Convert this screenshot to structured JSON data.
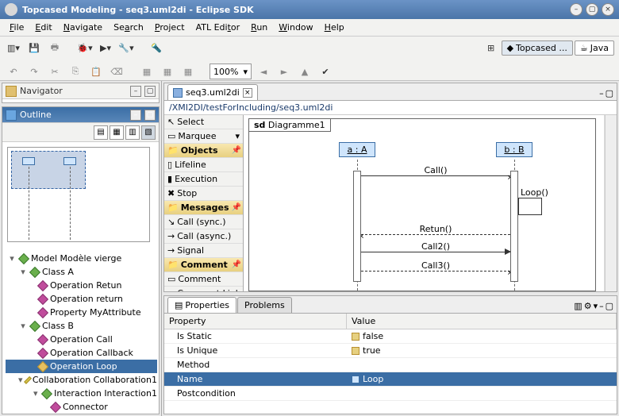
{
  "window": {
    "title": "Topcased Modeling - seq3.uml2di - Eclipse SDK"
  },
  "menus": [
    "File",
    "Edit",
    "Navigate",
    "Search",
    "Project",
    "ATL Editor",
    "Run",
    "Window",
    "Help"
  ],
  "zoom": "100%",
  "perspectives": {
    "active": "Topcased ...",
    "other": "Java"
  },
  "navigator": {
    "title": "Navigator"
  },
  "outline": {
    "title": "Outline",
    "root": "Model Modèle vierge",
    "classA": {
      "label": "Class A",
      "ops": [
        "Operation Retun",
        "Operation return",
        "Property MyAttribute"
      ]
    },
    "classB": {
      "label": "Class B",
      "ops": [
        "Operation Call",
        "Operation Callback",
        "Operation Loop"
      ]
    },
    "collab": "Collaboration Collaboration1",
    "interaction": "Interaction Interaction1",
    "connector": "Connector"
  },
  "editor": {
    "tab": "seq3.uml2di",
    "path": "/XMI2DI/testForIncluding/seq3.uml2di",
    "palette": {
      "select": "Select",
      "marquee": "Marquee",
      "objects": "Objects",
      "lifeline": "Lifeline",
      "execution": "Execution",
      "stop": "Stop",
      "messages": "Messages",
      "callsync": "Call (sync.)",
      "callasync": "Call (async.)",
      "signal": "Signal",
      "commenthdr": "Comment",
      "comment": "Comment",
      "commentlink": "Comment Link"
    },
    "diagram": {
      "frame": "sd Diagramme1",
      "lifelineA": "a : A",
      "lifelineB": "b : B",
      "msgs": {
        "call": "Call()",
        "loop": "Loop()",
        "retun": "Retun()",
        "call2": "Call2()",
        "call3": "Call3()"
      }
    }
  },
  "properties": {
    "tab1": "Properties",
    "tab2": "Problems",
    "headerProp": "Property",
    "headerVal": "Value",
    "rows": {
      "isStatic": {
        "k": "Is Static",
        "v": "false"
      },
      "isUnique": {
        "k": "Is Unique",
        "v": "true"
      },
      "method": {
        "k": "Method",
        "v": ""
      },
      "name": {
        "k": "Name",
        "v": "Loop"
      },
      "postcond": {
        "k": "Postcondition",
        "v": ""
      }
    }
  }
}
